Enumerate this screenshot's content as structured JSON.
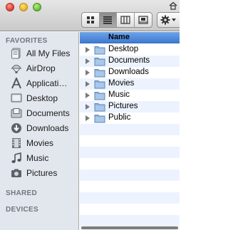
{
  "sidebar": {
    "favorites_heading": "FAVORITES",
    "shared_heading": "SHARED",
    "devices_heading": "DEVICES",
    "items": [
      {
        "label": "All My Files",
        "icon": "all-my-files-icon"
      },
      {
        "label": "AirDrop",
        "icon": "airdrop-icon"
      },
      {
        "label": "Applicati…",
        "icon": "applications-icon"
      },
      {
        "label": "Desktop",
        "icon": "desktop-icon"
      },
      {
        "label": "Documents",
        "icon": "documents-icon"
      },
      {
        "label": "Downloads",
        "icon": "downloads-icon"
      },
      {
        "label": "Movies",
        "icon": "movies-icon"
      },
      {
        "label": "Music",
        "icon": "music-icon"
      },
      {
        "label": "Pictures",
        "icon": "pictures-icon"
      }
    ]
  },
  "list": {
    "column_header": "Name",
    "rows": [
      {
        "name": "Desktop"
      },
      {
        "name": "Documents"
      },
      {
        "name": "Downloads"
      },
      {
        "name": "Movies"
      },
      {
        "name": "Music"
      },
      {
        "name": "Pictures"
      },
      {
        "name": "Public"
      }
    ]
  },
  "colors": {
    "accent": "#4a86d8",
    "sidebar_bg": "#e2e7ed",
    "folder": "#8fb4dc"
  }
}
